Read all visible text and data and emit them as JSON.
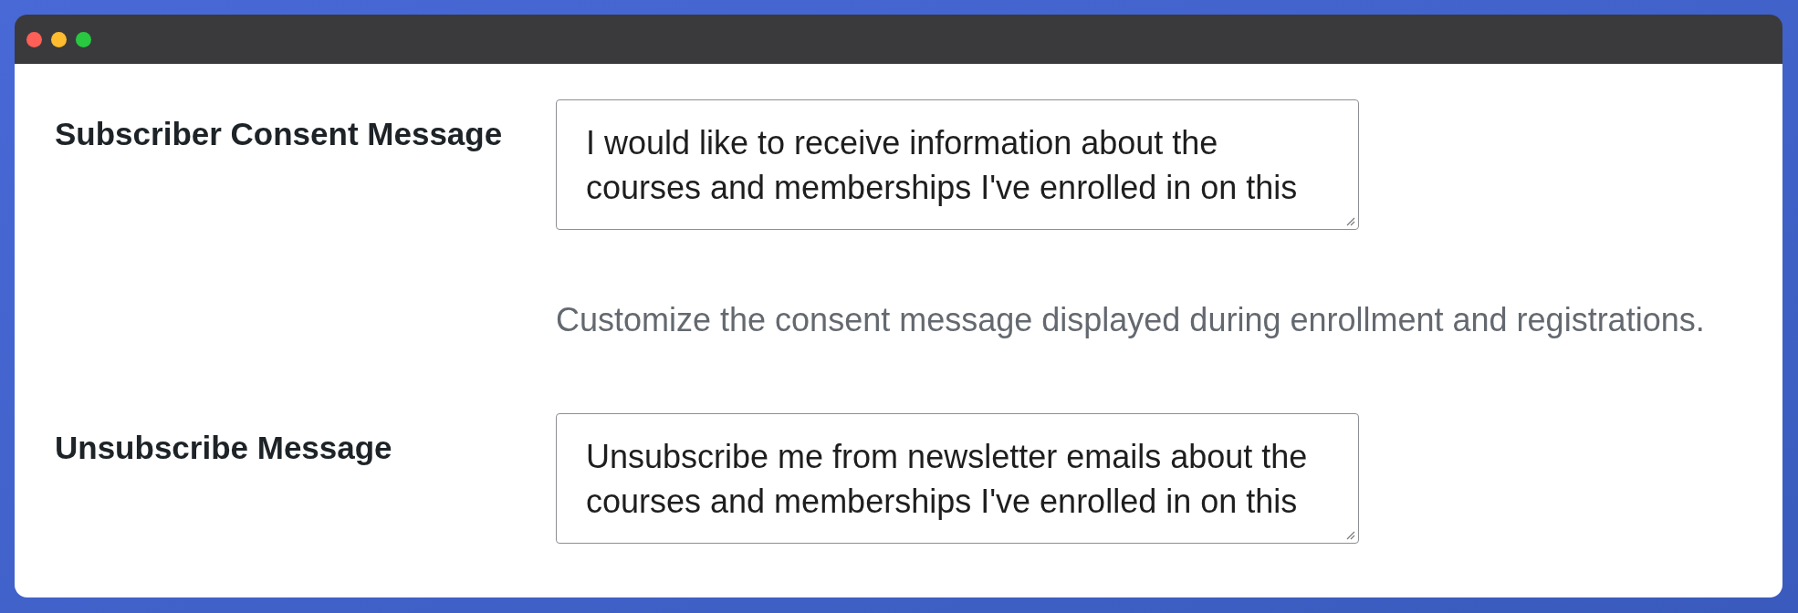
{
  "window": {
    "controls": [
      {
        "kind": "close"
      },
      {
        "kind": "minimize"
      },
      {
        "kind": "zoom"
      }
    ]
  },
  "fields": [
    {
      "label": "Subscriber Consent Message",
      "value": "I would like to receive information about the courses and memberships I've enrolled in on this",
      "description": "Customize the consent message displayed during enrollment and registrations."
    },
    {
      "label": "Unsubscribe Message",
      "value": "Unsubscribe me from newsletter emails about the courses and memberships I've enrolled in on this"
    }
  ]
}
